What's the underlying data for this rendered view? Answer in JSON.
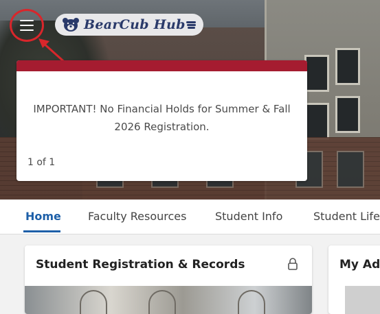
{
  "header": {
    "menu_icon": "hamburger-menu-icon",
    "logo_text": "BearCub Hub",
    "highlight_color": "#d9262b"
  },
  "announcement": {
    "message": "IMPORTANT! No Financial Holds for Summer & Fall 2026 Registration.",
    "pager": "1 of 1",
    "accent_color": "#a51c30"
  },
  "tabs": [
    {
      "label": "Home",
      "active": true
    },
    {
      "label": "Faculty Resources",
      "active": false
    },
    {
      "label": "Student Info",
      "active": false
    },
    {
      "label": "Student Life",
      "active": false
    }
  ],
  "cards": [
    {
      "title": "Student Registration & Records",
      "icon": "lock-icon"
    },
    {
      "title": "My Adı"
    }
  ]
}
